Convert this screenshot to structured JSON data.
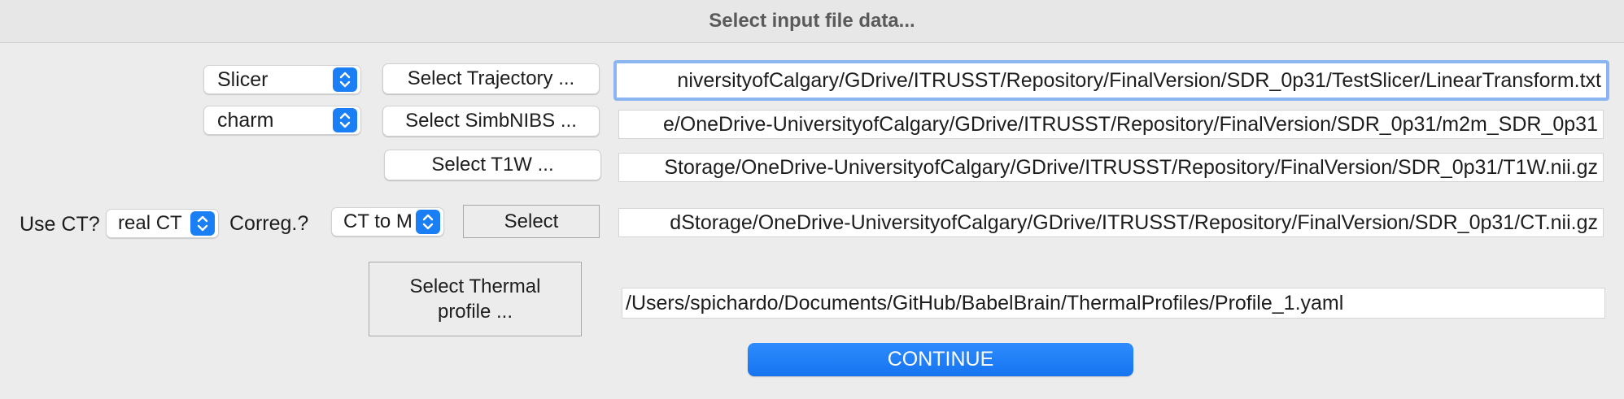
{
  "window": {
    "title": "Select input file data..."
  },
  "trajectory_row": {
    "source_select": {
      "value": "Slicer"
    },
    "button_label": "Select Trajectory ...",
    "path": "niversityofCalgary/GDrive/ITRUSST/Repository/FinalVersion/SDR_0p31/TestSlicer/LinearTransform.txt"
  },
  "simbnibs_row": {
    "source_select": {
      "value": "charm"
    },
    "button_label": "Select SimbNIBS ...",
    "path": "e/OneDrive-UniversityofCalgary/GDrive/ITRUSST/Repository/FinalVersion/SDR_0p31/m2m_SDR_0p31"
  },
  "t1w_row": {
    "button_label": "Select T1W ...",
    "path": "Storage/OneDrive-UniversityofCalgary/GDrive/ITRUSST/Repository/FinalVersion/SDR_0p31/T1W.nii.gz"
  },
  "ct_row": {
    "use_ct_label": "Use CT?",
    "use_ct_select": {
      "value": "real CT"
    },
    "correg_label": "Correg.?",
    "correg_select": {
      "value": "CT to M"
    },
    "button_label": "Select",
    "path": "dStorage/OneDrive-UniversityofCalgary/GDrive/ITRUSST/Repository/FinalVersion/SDR_0p31/CT.nii.gz"
  },
  "thermal_row": {
    "button_label_line1": "Select Thermal",
    "button_label_line2": "profile ...",
    "path": "/Users/spichardo/Documents/GitHub/BabelBrain/ThermalProfiles/Profile_1.yaml"
  },
  "continue_button": {
    "label": "CONTINUE"
  },
  "icons": {
    "stepper": "up-down-chevron-icon"
  },
  "colors": {
    "accent": "#1a7ef5",
    "focus_ring": "#8ab5f0",
    "background": "#ececec"
  }
}
